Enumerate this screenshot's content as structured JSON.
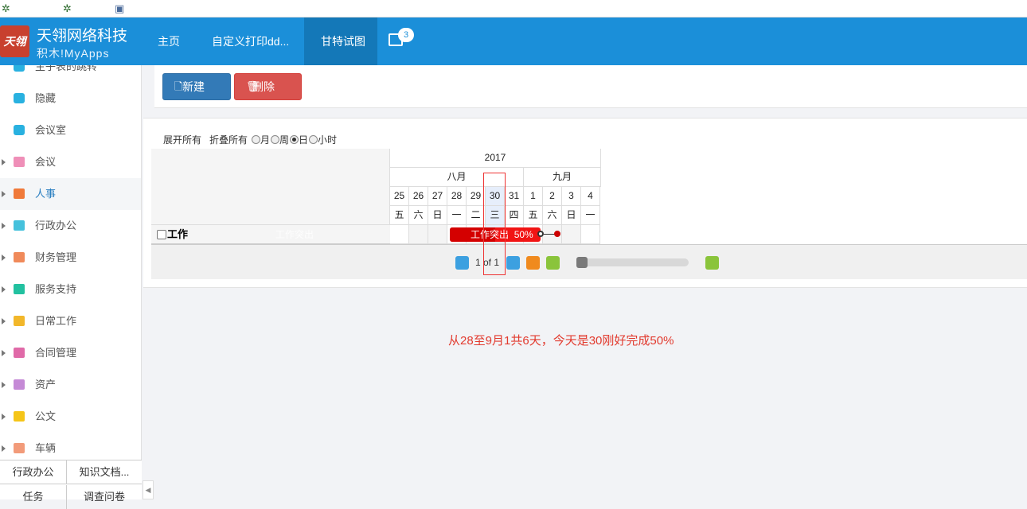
{
  "brand": {
    "title": "天翎网络科技",
    "subtitle": "积木!MyApps",
    "logo_text": "天翎"
  },
  "nav": {
    "home": "主页",
    "custom_print": "自定义打印dd...",
    "gantt": "甘特试图",
    "badge_count": "3"
  },
  "sidebar": {
    "items": [
      {
        "label": "主子表的跳转",
        "icon": "cube-icon",
        "color": "#29b1e0",
        "folder": false
      },
      {
        "label": "隐藏",
        "icon": "cube-icon",
        "color": "#29b1e0",
        "folder": false
      },
      {
        "label": "会议室",
        "icon": "cube-icon",
        "color": "#29b1e0",
        "folder": false
      },
      {
        "label": "会议",
        "icon": "folder-icon",
        "color": "#ef8fb8",
        "folder": true
      },
      {
        "label": "人事",
        "icon": "folder-icon",
        "color": "#f07a3a",
        "folder": true
      },
      {
        "label": "行政办公",
        "icon": "folder-icon",
        "color": "#45c1dc",
        "folder": true
      },
      {
        "label": "财务管理",
        "icon": "folder-icon",
        "color": "#f08a5a",
        "folder": true
      },
      {
        "label": "服务支持",
        "icon": "folder-icon",
        "color": "#22c1a0",
        "folder": true
      },
      {
        "label": "日常工作",
        "icon": "folder-icon",
        "color": "#f2b72a",
        "folder": true
      },
      {
        "label": "合同管理",
        "icon": "folder-icon",
        "color": "#e06aa8",
        "folder": true
      },
      {
        "label": "资产",
        "icon": "folder-icon",
        "color": "#c58ad6",
        "folder": true
      },
      {
        "label": "公文",
        "icon": "folder-icon",
        "color": "#f5c518",
        "folder": true
      },
      {
        "label": "车辆",
        "icon": "folder-icon",
        "color": "#f29b7a",
        "folder": true
      }
    ],
    "bottom_tabs": [
      "行政办公",
      "知识文档...",
      "任务",
      "调查问卷"
    ]
  },
  "toolbar": {
    "new_label": "新建",
    "delete_label": "删除"
  },
  "gantt": {
    "expand_all": "展开所有",
    "collapse_all": "折叠所有",
    "scales": {
      "month": "月",
      "week": "周",
      "day": "日",
      "hour": "小时"
    },
    "selected_scale": "day",
    "year": "2017",
    "months": [
      "八月",
      "九月"
    ],
    "days": [
      "25",
      "26",
      "27",
      "28",
      "29",
      "30",
      "31",
      "1",
      "2",
      "3",
      "4"
    ],
    "weekdays": [
      "五",
      "六",
      "日",
      "一",
      "二",
      "三",
      "四",
      "五",
      "六",
      "日",
      "一"
    ],
    "today_index": 5,
    "task": {
      "name": "工作",
      "ghost_label": "工作突出",
      "label": "工作突出",
      "percent_text": "50%",
      "progress": 0.5
    },
    "pager_text": "1 of 1"
  },
  "note": "从28至9月1共6天，今天是30刚好完成50%"
}
